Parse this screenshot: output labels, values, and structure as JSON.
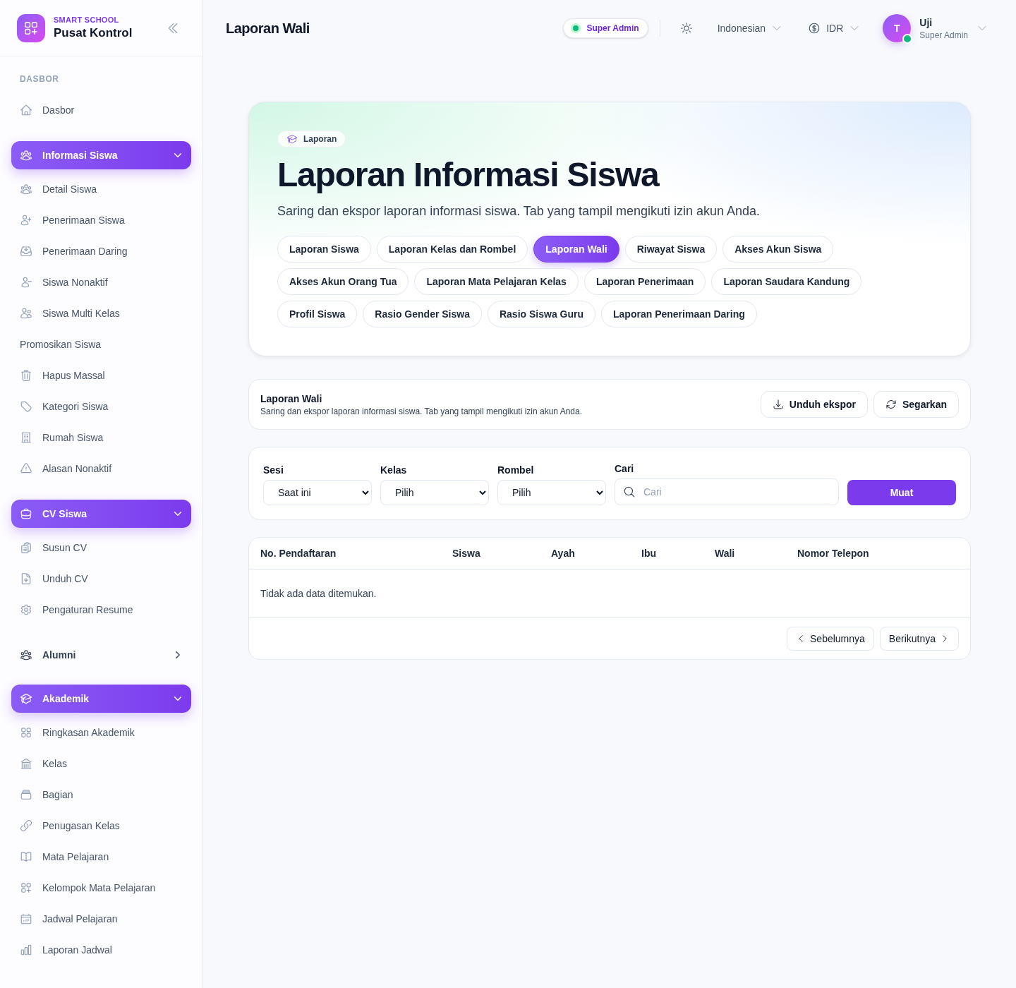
{
  "sidebar": {
    "brand": {
      "eyebrow": "SMART SCHOOL",
      "title": "Pusat Kontrol"
    },
    "section_label": "DASBOR",
    "items": [
      {
        "kind": "link",
        "label": "Dasbor"
      },
      {
        "kind": "group",
        "label": "Informasi Siswa",
        "expanded": true,
        "children": [
          {
            "label": "Detail Siswa"
          },
          {
            "label": "Penerimaan Siswa"
          },
          {
            "label": "Penerimaan Daring"
          },
          {
            "label": "Siswa Nonaktif"
          },
          {
            "label": "Siswa Multi Kelas"
          },
          {
            "label": "Promosikan Siswa"
          },
          {
            "label": "Hapus Massal"
          },
          {
            "label": "Kategori Siswa"
          },
          {
            "label": "Rumah Siswa"
          },
          {
            "label": "Alasan Nonaktif"
          }
        ]
      },
      {
        "kind": "group",
        "label": "CV Siswa",
        "expanded": true,
        "children": [
          {
            "label": "Susun CV"
          },
          {
            "label": "Unduh CV"
          },
          {
            "label": "Pengaturan Resume"
          }
        ]
      },
      {
        "kind": "group",
        "label": "Alumni",
        "expanded": false
      },
      {
        "kind": "group",
        "label": "Akademik",
        "expanded": true,
        "children": [
          {
            "label": "Ringkasan Akademik"
          },
          {
            "label": "Kelas"
          },
          {
            "label": "Bagian"
          },
          {
            "label": "Penugasan Kelas"
          },
          {
            "label": "Mata Pelajaran"
          },
          {
            "label": "Kelompok Mata Pelajaran"
          },
          {
            "label": "Jadwal Pelajaran"
          },
          {
            "label": "Laporan Jadwal"
          }
        ]
      }
    ]
  },
  "header": {
    "title": "Laporan Wali",
    "role_badge": "Super Admin",
    "language": "Indonesian",
    "currency": "IDR",
    "user": {
      "initial": "T",
      "name": "Uji",
      "role": "Super Admin",
      "online": true
    }
  },
  "hero": {
    "badge": "Laporan",
    "title": "Laporan Informasi Siswa",
    "subtitle": "Saring dan ekspor laporan informasi siswa. Tab yang tampil mengikuti izin akun Anda.",
    "tabs": [
      {
        "label": "Laporan Siswa",
        "selected": false
      },
      {
        "label": "Laporan Kelas dan Rombel",
        "selected": false
      },
      {
        "label": "Laporan Wali",
        "selected": true
      },
      {
        "label": "Riwayat Siswa",
        "selected": false
      },
      {
        "label": "Akses Akun Siswa",
        "selected": false
      },
      {
        "label": "Akses Akun Orang Tua",
        "selected": false
      },
      {
        "label": "Laporan Mata Pelajaran Kelas",
        "selected": false
      },
      {
        "label": "Laporan Penerimaan",
        "selected": false
      },
      {
        "label": "Laporan Saudara Kandung",
        "selected": false
      },
      {
        "label": "Profil Siswa",
        "selected": false
      },
      {
        "label": "Rasio Gender Siswa",
        "selected": false
      },
      {
        "label": "Rasio Siswa Guru",
        "selected": false
      },
      {
        "label": "Laporan Penerimaan Daring",
        "selected": false
      }
    ]
  },
  "report_bar": {
    "title": "Laporan Wali",
    "subtitle": "Saring dan ekspor laporan informasi siswa. Tab yang tampil mengikuti izin akun Anda.",
    "buttons": [
      "Unduh ekspor",
      "Segarkan"
    ]
  },
  "filters": {
    "fields": [
      {
        "kind": "select",
        "label": "Sesi",
        "value": "Saat ini"
      },
      {
        "kind": "select",
        "label": "Kelas",
        "value": "Pilih"
      },
      {
        "kind": "select",
        "label": "Rombel",
        "value": "Pilih"
      },
      {
        "kind": "search",
        "label": "Cari",
        "placeholder": "Cari"
      }
    ],
    "submit": "Muat"
  },
  "table": {
    "columns": [
      "No. Pendaftaran",
      "Siswa",
      "Ayah",
      "Ibu",
      "Wali",
      "Nomor Telepon"
    ],
    "empty_message": "Tidak ada data ditemukan.",
    "pagination": {
      "previous": "Sebelumnya",
      "next": "Berikutnya"
    }
  }
}
